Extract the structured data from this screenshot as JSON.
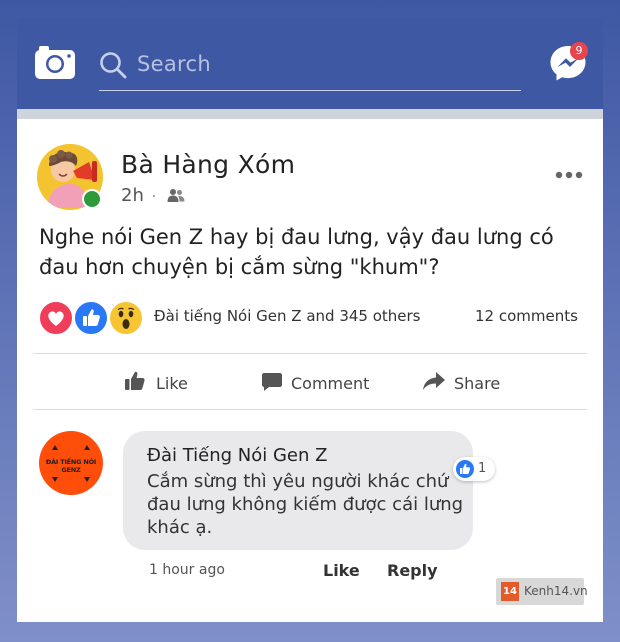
{
  "header": {
    "search_placeholder": "Search",
    "messenger_badge": "9",
    "icons": [
      "camera-icon",
      "search-icon",
      "messenger-icon"
    ]
  },
  "post": {
    "author": "Bà Hàng Xóm",
    "time": "2h",
    "meta_separator": "·",
    "audience_icon": "friends-icon",
    "text": "Nghe nói Gen Z hay bị đau lưng, vậy đau lưng có đau hơn chuyện bị cắm sừng \"khum\"?",
    "reactions": [
      "love",
      "like",
      "wow"
    ],
    "reactors_text": "Đài tiếng Nói Gen Z and 345 others",
    "comments_count": "12 comments",
    "actions": {
      "like": "Like",
      "comment": "Comment",
      "share": "Share"
    }
  },
  "comment": {
    "author": "Đài Tiếng Nói Gen Z",
    "avatar_text": "ĐÀI TIẾNG NÓI GENZ",
    "text": "Cắm sừng thì yêu người khác chứ đau lưng không kiếm được cái lưng khác ạ.",
    "like_count": "1",
    "time": "1 hour ago",
    "like_label": "Like",
    "reply_label": "Reply"
  },
  "watermark": {
    "logo": "14",
    "text": "Kenh14.vn"
  },
  "colors": {
    "brand_blue": "#3f58a3",
    "badge_red": "#e8444e",
    "love_red": "#f03e5a",
    "like_blue": "#2a78f5",
    "wow_yellow": "#f7c531",
    "online_green": "#2e9b3a",
    "page_avatar_orange": "#ff4d0a"
  }
}
